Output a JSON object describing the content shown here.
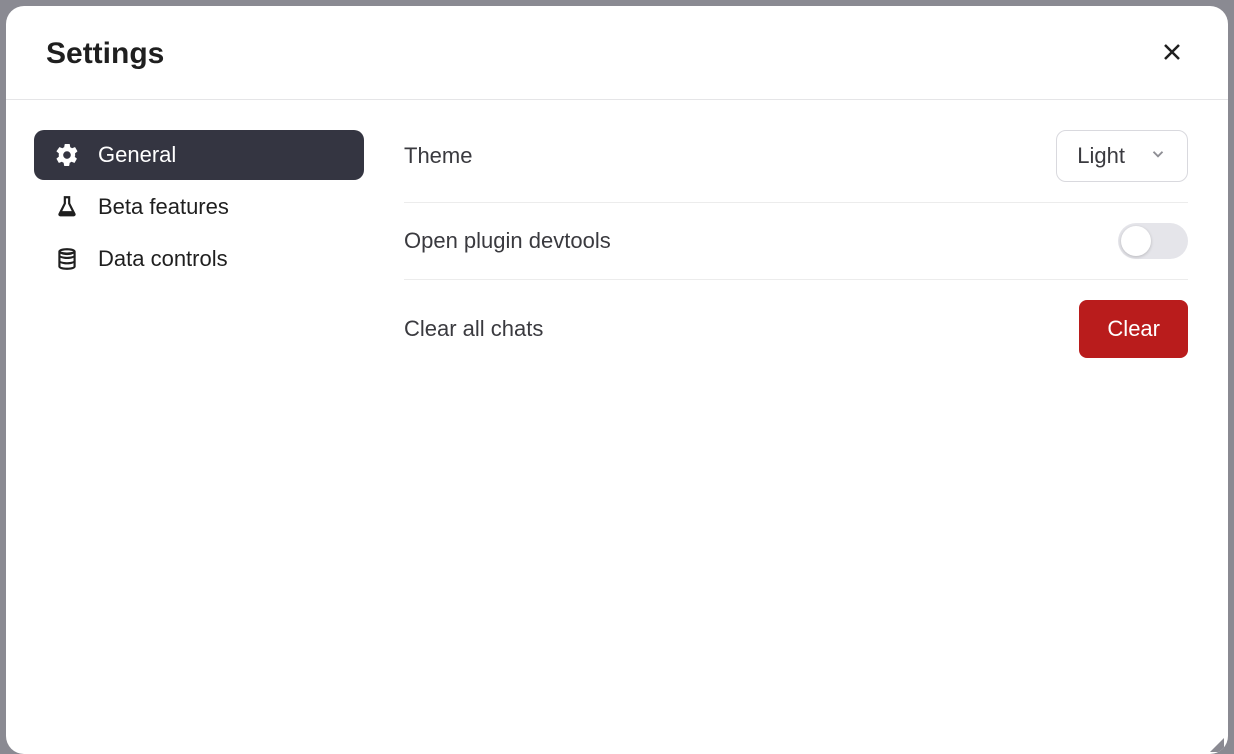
{
  "header": {
    "title": "Settings"
  },
  "sidebar": {
    "items": [
      {
        "label": "General",
        "icon": "gear",
        "active": true
      },
      {
        "label": "Beta features",
        "icon": "flask",
        "active": false
      },
      {
        "label": "Data controls",
        "icon": "database",
        "active": false
      }
    ]
  },
  "settings": {
    "theme": {
      "label": "Theme",
      "value": "Light"
    },
    "plugin_devtools": {
      "label": "Open plugin devtools",
      "enabled": false
    },
    "clear_chats": {
      "label": "Clear all chats",
      "button": "Clear"
    }
  }
}
